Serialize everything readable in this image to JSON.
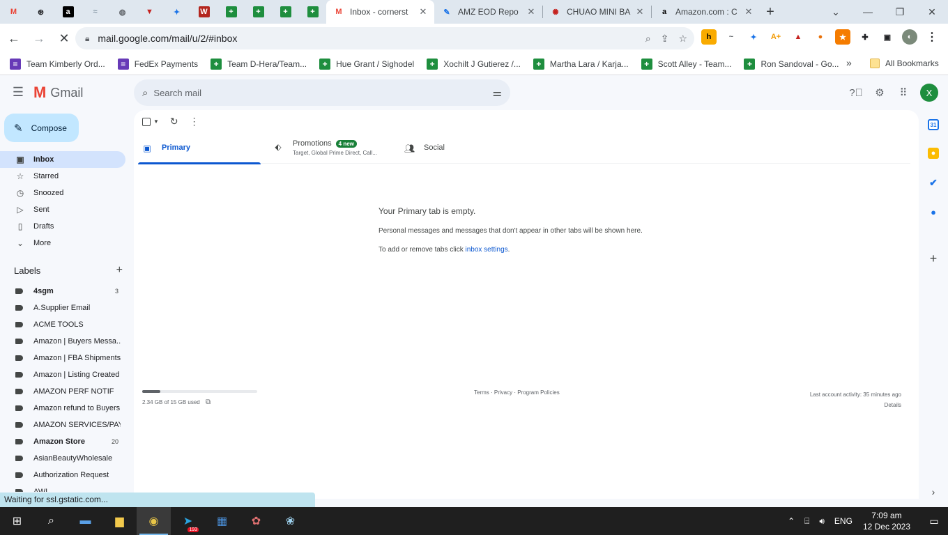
{
  "browser": {
    "pinned_tabs": [
      {
        "icon": "gmail-icon",
        "glyph": "M",
        "color": "#ea4335"
      },
      {
        "icon": "openai-icon",
        "glyph": "⊛",
        "color": "#202124"
      },
      {
        "icon": "amazon-icon",
        "glyph": "a",
        "color": "#000000"
      },
      {
        "icon": "helium-icon",
        "glyph": "≈",
        "color": "#8a9aa8"
      },
      {
        "icon": "globe-icon",
        "glyph": "◍",
        "color": "#5f6368"
      },
      {
        "icon": "vpn-icon",
        "glyph": "▼",
        "color": "#c5221f"
      },
      {
        "icon": "lifebuoy-icon",
        "glyph": "✦",
        "color": "#1a73e8"
      },
      {
        "icon": "walmart-w-icon",
        "glyph": "W",
        "color": "#b3261e"
      },
      {
        "icon": "sheets-icon",
        "glyph": "+",
        "color": "#1e8e3e"
      },
      {
        "icon": "sheets-icon",
        "glyph": "+",
        "color": "#1e8e3e"
      },
      {
        "icon": "sheets-icon",
        "glyph": "+",
        "color": "#1e8e3e"
      },
      {
        "icon": "sheets-icon",
        "glyph": "+",
        "color": "#1e8e3e"
      }
    ],
    "tabs": [
      {
        "title": "Inbox - cornerst",
        "icon": "gmail-icon",
        "glyph": "M",
        "color": "#ea4335",
        "active": true
      },
      {
        "title": "AMZ EOD Repo",
        "icon": "pencil-icon",
        "glyph": "✎",
        "color": "#1a73e8",
        "active": false
      },
      {
        "title": "CHUAO MINI BA",
        "icon": "peppermint-icon",
        "glyph": "✺",
        "color": "#c5221f",
        "active": false
      },
      {
        "title": "Amazon.com : C",
        "icon": "amazon-icon",
        "glyph": "a",
        "color": "#000000",
        "active": false
      }
    ],
    "url": "mail.google.com/mail/u/2/#inbox",
    "extensions": [
      {
        "name": "honey-extension-icon",
        "glyph": "h",
        "bg": "#f9ab00",
        "fg": "#000"
      },
      {
        "name": "logo-extension-icon",
        "glyph": "~",
        "bg": "#ffffff",
        "fg": "#5f6368"
      },
      {
        "name": "lifebuoy-extension-icon",
        "glyph": "✦",
        "bg": "#ffffff",
        "fg": "#1a73e8"
      },
      {
        "name": "boost-extension-icon",
        "glyph": "A+",
        "bg": "#ffffff",
        "fg": "#f29900"
      },
      {
        "name": "alert-extension-icon",
        "glyph": "▲",
        "bg": "#ffffff",
        "fg": "#c5221f"
      },
      {
        "name": "orange-circle-extension-icon",
        "glyph": "●",
        "bg": "#ffffff",
        "fg": "#e8710a"
      },
      {
        "name": "star-extension-icon",
        "glyph": "★",
        "bg": "#f57c00",
        "fg": "#fff"
      },
      {
        "name": "puzzle-extensions-icon",
        "glyph": "✚",
        "bg": "#ffffff",
        "fg": "#202124"
      },
      {
        "name": "side-panel-icon",
        "glyph": "▣",
        "bg": "#ffffff",
        "fg": "#202124"
      }
    ],
    "bookmarks": [
      {
        "label": "Team Kimberly Ord...",
        "kind": "forms"
      },
      {
        "label": "FedEx Payments",
        "kind": "forms"
      },
      {
        "label": "Team D-Hera/Team...",
        "kind": "sheets"
      },
      {
        "label": "Hue Grant / Sighodel",
        "kind": "sheets"
      },
      {
        "label": "Xochilt J Gutierez /...",
        "kind": "sheets"
      },
      {
        "label": "Martha Lara / Karja...",
        "kind": "sheets"
      },
      {
        "label": "Scott Alley - Team...",
        "kind": "sheets"
      },
      {
        "label": "Ron Sandoval - Go...",
        "kind": "sheets"
      }
    ],
    "bookmarks_overflow": "»",
    "all_bookmarks": "All Bookmarks",
    "status_text": "Waiting for ssl.gstatic.com..."
  },
  "gmail": {
    "brand": "Gmail",
    "search_placeholder": "Search mail",
    "avatar_letter": "X",
    "compose_label": "Compose",
    "nav": [
      {
        "label": "Inbox",
        "icon": "inbox-icon",
        "glyph": "▣",
        "active": true
      },
      {
        "label": "Starred",
        "icon": "star-icon",
        "glyph": "☆",
        "active": false
      },
      {
        "label": "Snoozed",
        "icon": "clock-icon",
        "glyph": "◷",
        "active": false
      },
      {
        "label": "Sent",
        "icon": "send-icon",
        "glyph": "▷",
        "active": false
      },
      {
        "label": "Drafts",
        "icon": "draft-icon",
        "glyph": "▯",
        "active": false
      },
      {
        "label": "More",
        "icon": "chevron-down-icon",
        "glyph": "⌄",
        "active": false
      }
    ],
    "labels_title": "Labels",
    "labels": [
      {
        "name": "4sgm",
        "count": "3",
        "bold": true
      },
      {
        "name": "A.Supplier Email",
        "count": "",
        "bold": false
      },
      {
        "name": "ACME TOOLS",
        "count": "",
        "bold": false
      },
      {
        "name": "Amazon | Buyers Messa...",
        "count": "",
        "bold": false
      },
      {
        "name": "Amazon | FBA Shipments",
        "count": "",
        "bold": false
      },
      {
        "name": "Amazon | Listing Created",
        "count": "",
        "bold": false
      },
      {
        "name": "AMAZON PERF NOTIF",
        "count": "",
        "bold": false
      },
      {
        "name": "Amazon refund to Buyers",
        "count": "",
        "bold": false
      },
      {
        "name": "AMAZON SERVICES/PAY...",
        "count": "",
        "bold": false
      },
      {
        "name": "Amazon Store",
        "count": "20",
        "bold": true
      },
      {
        "name": "AsianBeautyWholesale",
        "count": "",
        "bold": false
      },
      {
        "name": "Authorization Request",
        "count": "",
        "bold": false
      },
      {
        "name": "AWL",
        "count": "",
        "bold": false
      }
    ],
    "tabs": {
      "primary": "Primary",
      "promotions": "Promotions",
      "promotions_badge": "4 new",
      "promotions_senders": "Target, Global Prime Direct, Call...",
      "social": "Social"
    },
    "empty": {
      "title": "Your Primary tab is empty.",
      "body": "Personal messages and messages that don't appear in other tabs will be shown here.",
      "hint_prefix": "To add or remove tabs click ",
      "hint_link": "inbox settings",
      "hint_suffix": "."
    },
    "footer": {
      "storage": "2.34 GB of 15 GB used",
      "storage_fraction": 0.156,
      "links": "Terms · Privacy · Program Policies",
      "activity": "Last account activity: 35 minutes ago",
      "details": "Details"
    }
  },
  "taskbar": {
    "items": [
      {
        "name": "windows-start-icon",
        "glyph": "⊞",
        "active": false
      },
      {
        "name": "search-icon",
        "glyph": "⌕",
        "active": false
      },
      {
        "name": "file-explorer-app-icon",
        "glyph": "▬",
        "active": false
      },
      {
        "name": "folder-icon",
        "glyph": "▆",
        "active": false
      },
      {
        "name": "chrome-icon",
        "glyph": "◉",
        "active": true
      },
      {
        "name": "telegram-icon",
        "glyph": "➤",
        "active": false,
        "badge": "193"
      },
      {
        "name": "calculator-icon",
        "glyph": "▦",
        "active": false
      },
      {
        "name": "paint-icon",
        "glyph": "✿",
        "active": false
      },
      {
        "name": "paint-3d-icon",
        "glyph": "❀",
        "active": false
      }
    ],
    "language": "ENG",
    "time": "7:09 am",
    "date": "12 Dec 2023"
  }
}
